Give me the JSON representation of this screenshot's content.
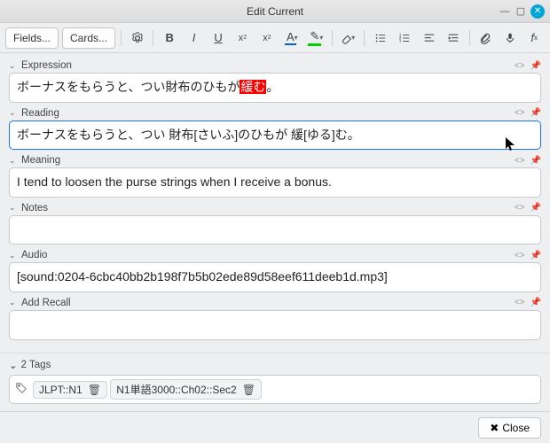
{
  "window": {
    "title": "Edit Current"
  },
  "toolbar": {
    "fields_btn": "Fields...",
    "cards_btn": "Cards..."
  },
  "fields": [
    {
      "label": "Expression",
      "value_html": "ボーナスをもらうと、つい財布のひもが<span class='hl-red'>緩む</span>。",
      "focused": false
    },
    {
      "label": "Reading",
      "value_html": "ボーナスをもらうと、つい 財布[さいふ]のひもが 緩[ゆる]む。",
      "focused": true
    },
    {
      "label": "Meaning",
      "value_html": "I tend to loosen the purse strings when I receive a bonus.",
      "focused": false
    },
    {
      "label": "Notes",
      "value_html": "",
      "focused": false
    },
    {
      "label": "Audio",
      "value_html": "[sound:0204-6cbc40bb2b198f7b5b02ede89d58eef611deeb1d.mp3]",
      "focused": false
    },
    {
      "label": "Add Recall",
      "value_html": "",
      "focused": false
    }
  ],
  "tags": {
    "label": "2 Tags",
    "items": [
      "JLPT::N1",
      "N1単語3000::Ch02::Sec2"
    ]
  },
  "footer": {
    "close": "Close"
  }
}
